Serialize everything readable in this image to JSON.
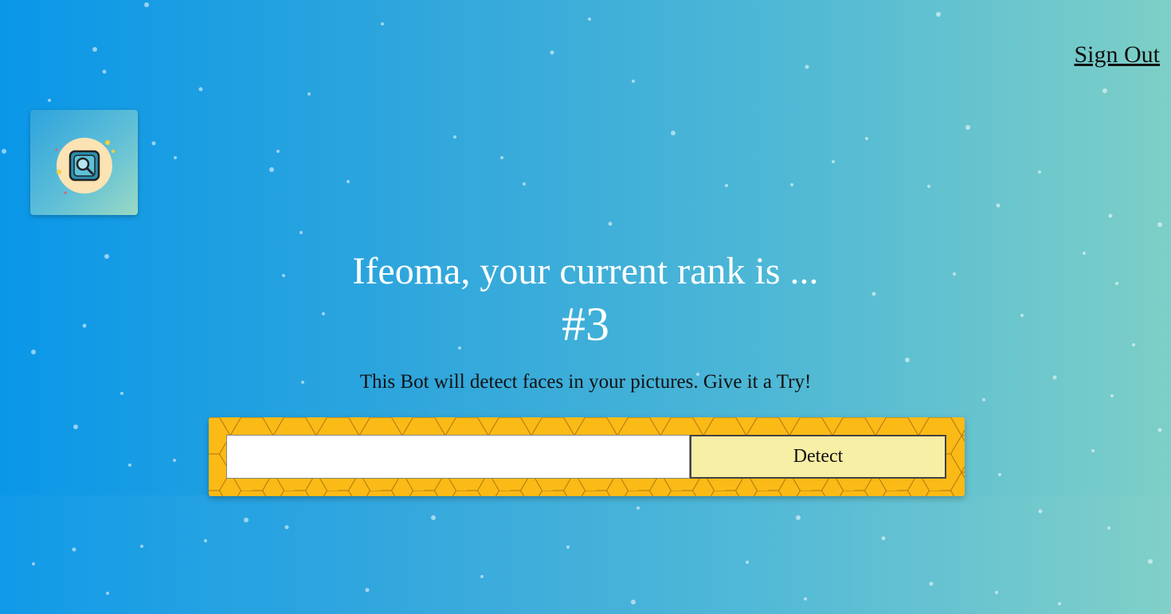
{
  "nav": {
    "signout_label": "Sign Out"
  },
  "logo": {
    "icon": "magnifier-face-icon"
  },
  "rank": {
    "headline": "Ifeoma, your current rank is ...",
    "value": "#3"
  },
  "intro": {
    "text": "This Bot will detect faces in your pictures. Give it a Try!"
  },
  "form": {
    "input_value": "",
    "input_placeholder": "",
    "detect_label": "Detect"
  },
  "colors": {
    "background_start": "#0a97e8",
    "background_end": "#7dcfc7",
    "form_bg": "#fbba16",
    "button_bg": "#f8efa6"
  }
}
